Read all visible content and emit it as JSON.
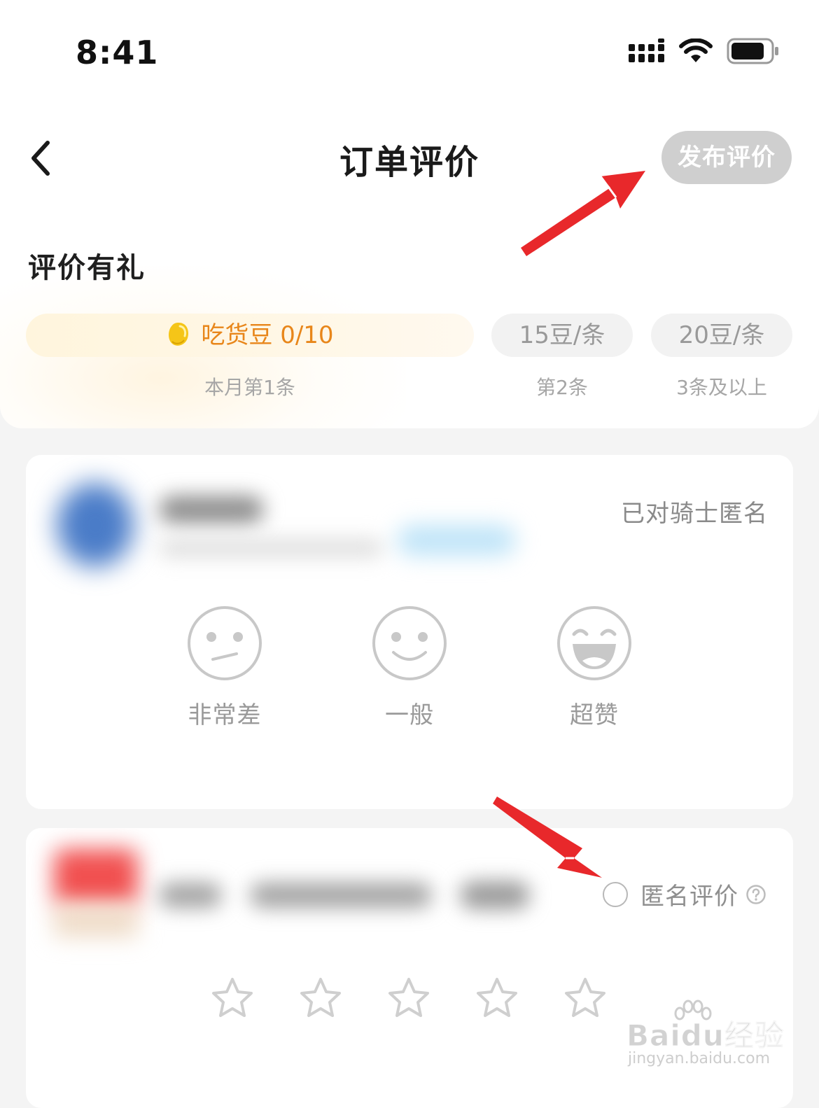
{
  "status_bar": {
    "time": "8:41"
  },
  "nav": {
    "title": "订单评价",
    "publish_label": "发布评价"
  },
  "reward": {
    "title": "评价有礼",
    "tiers": [
      {
        "label": "吃货豆 0/10",
        "sub": "本月第1条"
      },
      {
        "label": "15豆/条",
        "sub": "第2条"
      },
      {
        "label": "20豆/条",
        "sub": "3条及以上"
      }
    ]
  },
  "rider_card": {
    "anon_note": "已对骑士匿名",
    "ratings": [
      {
        "label": "非常差",
        "icon": "sad-face-icon"
      },
      {
        "label": "一般",
        "icon": "smile-face-icon"
      },
      {
        "label": "超赞",
        "icon": "laugh-face-icon"
      }
    ]
  },
  "shop_card": {
    "anon_label": "匿名评价",
    "anon_checked": false,
    "stars_total": 5,
    "stars_selected": 0
  },
  "watermark": {
    "text": "Baidu经验",
    "sub": "jingyan.baidu.com"
  },
  "colors": {
    "accent_orange": "#e8861a",
    "annotation_red": "#e8282b",
    "disabled_button": "#cfcfcf"
  }
}
